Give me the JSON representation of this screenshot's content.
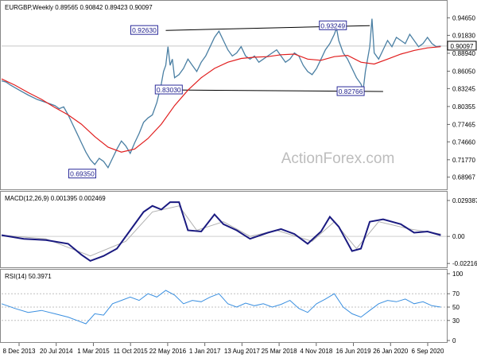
{
  "chart_data": [
    {
      "type": "line",
      "panel": "price",
      "title": "EURGBP,Weekly",
      "ohlc": {
        "open": "0.89565",
        "high": "0.90842",
        "low": "0.89423",
        "close": "0.90097"
      },
      "ylim": [
        0.67,
        0.965
      ],
      "y_ticks": [
        "0.94650",
        "0.91830",
        "0.88940",
        "0.86050",
        "0.83245",
        "0.80355",
        "0.77465",
        "0.74660",
        "0.71770",
        "0.68967"
      ],
      "y_tick_values": [
        0.9465,
        0.9183,
        0.8894,
        0.8605,
        0.83245,
        0.80355,
        0.77465,
        0.7466,
        0.7177,
        0.68967
      ],
      "last_price": "0.90097",
      "x_tick_labels": [
        "8 Dec 2013",
        "20 Jul 2014",
        "1 Mar 2015",
        "11 Oct 2015",
        "22 May 2016",
        "1 Jan 2017",
        "13 Aug 2017",
        "25 Mar 2018",
        "4 Nov 2018",
        "16 Jun 2019",
        "26 Jan 2020",
        "6 Sep 2020"
      ],
      "annotations": [
        "0.92630",
        "0.93249",
        "0.83030",
        "0.82766",
        "0.69350"
      ],
      "price_points": [
        [
          0,
          0.845
        ],
        [
          0.01,
          0.843
        ],
        [
          0.02,
          0.838
        ],
        [
          0.04,
          0.83
        ],
        [
          0.06,
          0.822
        ],
        [
          0.08,
          0.815
        ],
        [
          0.1,
          0.81
        ],
        [
          0.12,
          0.805
        ],
        [
          0.13,
          0.8
        ],
        [
          0.14,
          0.803
        ],
        [
          0.15,
          0.79
        ],
        [
          0.16,
          0.775
        ],
        [
          0.17,
          0.76
        ],
        [
          0.18,
          0.745
        ],
        [
          0.19,
          0.73
        ],
        [
          0.2,
          0.718
        ],
        [
          0.21,
          0.71
        ],
        [
          0.22,
          0.72
        ],
        [
          0.23,
          0.715
        ],
        [
          0.24,
          0.705
        ],
        [
          0.25,
          0.72
        ],
        [
          0.26,
          0.735
        ],
        [
          0.27,
          0.748
        ],
        [
          0.28,
          0.74
        ],
        [
          0.29,
          0.728
        ],
        [
          0.3,
          0.745
        ],
        [
          0.31,
          0.76
        ],
        [
          0.32,
          0.778
        ],
        [
          0.33,
          0.785
        ],
        [
          0.34,
          0.79
        ],
        [
          0.35,
          0.81
        ],
        [
          0.36,
          0.84
        ],
        [
          0.365,
          0.86
        ],
        [
          0.37,
          0.87
        ],
        [
          0.375,
          0.9
        ],
        [
          0.38,
          0.87
        ],
        [
          0.385,
          0.88
        ],
        [
          0.39,
          0.85
        ],
        [
          0.4,
          0.855
        ],
        [
          0.41,
          0.865
        ],
        [
          0.42,
          0.88
        ],
        [
          0.43,
          0.87
        ],
        [
          0.44,
          0.86
        ],
        [
          0.45,
          0.875
        ],
        [
          0.46,
          0.885
        ],
        [
          0.47,
          0.9
        ],
        [
          0.48,
          0.915
        ],
        [
          0.49,
          0.925
        ],
        [
          0.5,
          0.91
        ],
        [
          0.51,
          0.895
        ],
        [
          0.52,
          0.885
        ],
        [
          0.53,
          0.89
        ],
        [
          0.54,
          0.9
        ],
        [
          0.55,
          0.885
        ],
        [
          0.56,
          0.88
        ],
        [
          0.57,
          0.885
        ],
        [
          0.58,
          0.875
        ],
        [
          0.59,
          0.88
        ],
        [
          0.6,
          0.885
        ],
        [
          0.61,
          0.89
        ],
        [
          0.62,
          0.895
        ],
        [
          0.63,
          0.885
        ],
        [
          0.64,
          0.875
        ],
        [
          0.65,
          0.88
        ],
        [
          0.66,
          0.89
        ],
        [
          0.67,
          0.885
        ],
        [
          0.68,
          0.87
        ],
        [
          0.69,
          0.86
        ],
        [
          0.7,
          0.855
        ],
        [
          0.71,
          0.865
        ],
        [
          0.72,
          0.88
        ],
        [
          0.73,
          0.895
        ],
        [
          0.74,
          0.905
        ],
        [
          0.75,
          0.92
        ],
        [
          0.755,
          0.93
        ],
        [
          0.76,
          0.91
        ],
        [
          0.77,
          0.89
        ],
        [
          0.78,
          0.88
        ],
        [
          0.79,
          0.865
        ],
        [
          0.8,
          0.85
        ],
        [
          0.81,
          0.84
        ],
        [
          0.815,
          0.83
        ],
        [
          0.82,
          0.86
        ],
        [
          0.83,
          0.9
        ],
        [
          0.835,
          0.945
        ],
        [
          0.84,
          0.89
        ],
        [
          0.85,
          0.88
        ],
        [
          0.86,
          0.895
        ],
        [
          0.87,
          0.91
        ],
        [
          0.88,
          0.9
        ],
        [
          0.89,
          0.915
        ],
        [
          0.9,
          0.91
        ],
        [
          0.91,
          0.905
        ],
        [
          0.92,
          0.92
        ],
        [
          0.93,
          0.91
        ],
        [
          0.94,
          0.9
        ],
        [
          0.95,
          0.905
        ],
        [
          0.96,
          0.915
        ],
        [
          0.97,
          0.905
        ],
        [
          0.98,
          0.9
        ],
        [
          0.99,
          0.901
        ]
      ],
      "ma_points": [
        [
          0,
          0.848
        ],
        [
          0.03,
          0.838
        ],
        [
          0.06,
          0.826
        ],
        [
          0.09,
          0.815
        ],
        [
          0.12,
          0.802
        ],
        [
          0.15,
          0.79
        ],
        [
          0.18,
          0.775
        ],
        [
          0.21,
          0.755
        ],
        [
          0.24,
          0.738
        ],
        [
          0.27,
          0.73
        ],
        [
          0.3,
          0.735
        ],
        [
          0.33,
          0.752
        ],
        [
          0.36,
          0.775
        ],
        [
          0.39,
          0.805
        ],
        [
          0.42,
          0.83
        ],
        [
          0.45,
          0.85
        ],
        [
          0.48,
          0.865
        ],
        [
          0.51,
          0.875
        ],
        [
          0.54,
          0.881
        ],
        [
          0.57,
          0.883
        ],
        [
          0.6,
          0.884
        ],
        [
          0.63,
          0.887
        ],
        [
          0.66,
          0.888
        ],
        [
          0.69,
          0.88
        ],
        [
          0.72,
          0.878
        ],
        [
          0.75,
          0.884
        ],
        [
          0.78,
          0.886
        ],
        [
          0.81,
          0.875
        ],
        [
          0.84,
          0.872
        ],
        [
          0.87,
          0.88
        ],
        [
          0.9,
          0.888
        ],
        [
          0.93,
          0.894
        ],
        [
          0.96,
          0.898
        ],
        [
          0.99,
          0.9
        ]
      ],
      "channel_upper": [
        [
          0.37,
          0.9263
        ],
        [
          0.83,
          0.934
        ]
      ],
      "channel_lower": [
        [
          0.37,
          0.8303
        ],
        [
          0.86,
          0.8277
        ]
      ]
    },
    {
      "type": "line",
      "panel": "macd",
      "title": "MACD(12,26,9) 0.001395 0.002469",
      "ylim": [
        -0.024,
        0.032
      ],
      "y_ticks": [
        "0.029387",
        "0.00",
        "-0.022161"
      ],
      "y_tick_values": [
        0.029387,
        0.0,
        -0.022161
      ],
      "macd_points": [
        [
          0,
          0.001
        ],
        [
          0.05,
          -0.002
        ],
        [
          0.1,
          -0.003
        ],
        [
          0.15,
          -0.006
        ],
        [
          0.18,
          -0.015
        ],
        [
          0.2,
          -0.02
        ],
        [
          0.23,
          -0.016
        ],
        [
          0.26,
          -0.01
        ],
        [
          0.29,
          0.005
        ],
        [
          0.32,
          0.02
        ],
        [
          0.34,
          0.025
        ],
        [
          0.36,
          0.022
        ],
        [
          0.38,
          0.028
        ],
        [
          0.4,
          0.028
        ],
        [
          0.42,
          0.005
        ],
        [
          0.45,
          0.004
        ],
        [
          0.48,
          0.018
        ],
        [
          0.5,
          0.01
        ],
        [
          0.53,
          0.005
        ],
        [
          0.56,
          -0.002
        ],
        [
          0.6,
          0.003
        ],
        [
          0.63,
          0.006
        ],
        [
          0.66,
          0.002
        ],
        [
          0.69,
          -0.006
        ],
        [
          0.72,
          0.004
        ],
        [
          0.74,
          0.016
        ],
        [
          0.76,
          0.008
        ],
        [
          0.79,
          -0.012
        ],
        [
          0.81,
          -0.01
        ],
        [
          0.83,
          0.012
        ],
        [
          0.86,
          0.014
        ],
        [
          0.9,
          0.01
        ],
        [
          0.93,
          0.003
        ],
        [
          0.96,
          0.004
        ],
        [
          0.99,
          0.001
        ]
      ],
      "signal_points": [
        [
          0,
          0.001
        ],
        [
          0.1,
          -0.002
        ],
        [
          0.2,
          -0.016
        ],
        [
          0.28,
          -0.004
        ],
        [
          0.34,
          0.02
        ],
        [
          0.4,
          0.025
        ],
        [
          0.44,
          0.005
        ],
        [
          0.5,
          0.012
        ],
        [
          0.56,
          0.0
        ],
        [
          0.62,
          0.005
        ],
        [
          0.7,
          -0.004
        ],
        [
          0.75,
          0.012
        ],
        [
          0.8,
          -0.01
        ],
        [
          0.85,
          0.012
        ],
        [
          0.92,
          0.006
        ],
        [
          0.99,
          0.002
        ]
      ]
    },
    {
      "type": "line",
      "panel": "rsi",
      "title": "RSI(14) 50.3971",
      "ylim": [
        0,
        100
      ],
      "y_ticks": [
        "100",
        "70",
        "50",
        "30",
        "0"
      ],
      "y_tick_values": [
        100,
        70,
        50,
        30,
        0
      ],
      "rsi_points": [
        [
          0,
          55
        ],
        [
          0.03,
          48
        ],
        [
          0.06,
          42
        ],
        [
          0.09,
          45
        ],
        [
          0.12,
          40
        ],
        [
          0.15,
          35
        ],
        [
          0.17,
          30
        ],
        [
          0.19,
          25
        ],
        [
          0.21,
          40
        ],
        [
          0.23,
          38
        ],
        [
          0.25,
          55
        ],
        [
          0.27,
          60
        ],
        [
          0.29,
          65
        ],
        [
          0.31,
          60
        ],
        [
          0.33,
          70
        ],
        [
          0.35,
          65
        ],
        [
          0.37,
          75
        ],
        [
          0.39,
          68
        ],
        [
          0.41,
          55
        ],
        [
          0.43,
          60
        ],
        [
          0.45,
          58
        ],
        [
          0.47,
          65
        ],
        [
          0.49,
          70
        ],
        [
          0.51,
          55
        ],
        [
          0.53,
          50
        ],
        [
          0.55,
          56
        ],
        [
          0.57,
          52
        ],
        [
          0.59,
          55
        ],
        [
          0.61,
          50
        ],
        [
          0.63,
          54
        ],
        [
          0.65,
          60
        ],
        [
          0.67,
          48
        ],
        [
          0.69,
          42
        ],
        [
          0.71,
          55
        ],
        [
          0.73,
          62
        ],
        [
          0.75,
          70
        ],
        [
          0.77,
          50
        ],
        [
          0.79,
          40
        ],
        [
          0.81,
          35
        ],
        [
          0.83,
          45
        ],
        [
          0.85,
          55
        ],
        [
          0.87,
          60
        ],
        [
          0.89,
          58
        ],
        [
          0.91,
          62
        ],
        [
          0.93,
          55
        ],
        [
          0.95,
          58
        ],
        [
          0.97,
          52
        ],
        [
          0.99,
          50
        ]
      ]
    }
  ],
  "watermark": "ActionForex.com",
  "colors": {
    "price": "#4a7fa3",
    "ma": "#e11e1e",
    "channel": "#000000",
    "macd": "#1a1a80",
    "signal": "#b0b0b0",
    "rsi": "#3a8fe0",
    "label_border": "#2b2b9a",
    "label_text": "#1b1b8a"
  }
}
